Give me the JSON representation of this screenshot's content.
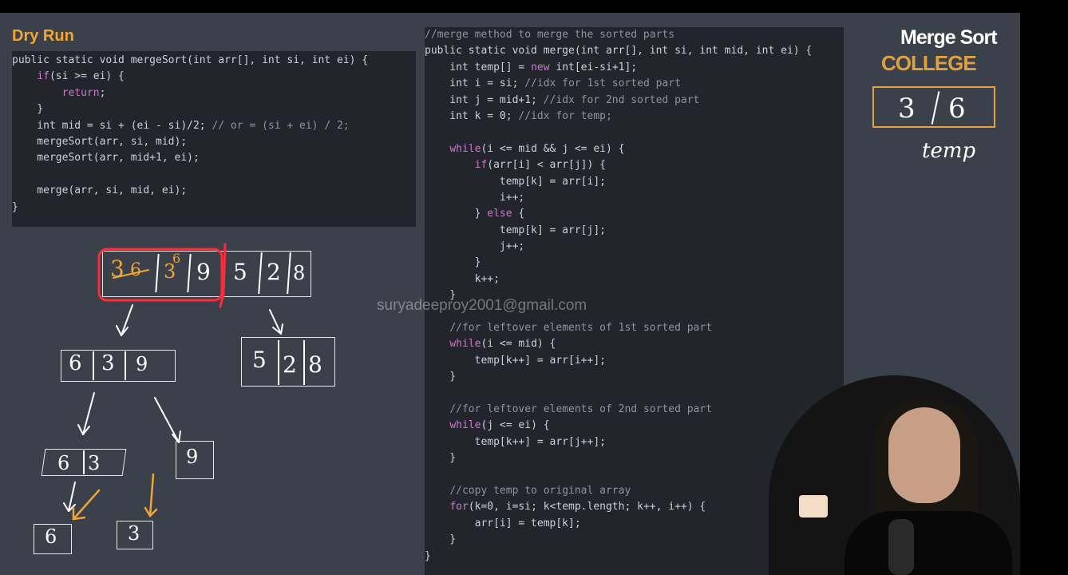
{
  "dry_run_title": "Dry Run",
  "brand_title": "Merge Sort",
  "brand_logo": "COLLEGE",
  "watermark": "suryadeeproy2001@gmail.com",
  "temp_label": "temp",
  "temp_values": [
    "3",
    "6"
  ],
  "merge_sort_code": [
    [
      {
        "t": "public static void mergeSort(int arr[], int si, int ei) {",
        "c": ""
      }
    ],
    [
      {
        "t": "    ",
        "c": ""
      },
      {
        "t": "if",
        "c": "k"
      },
      {
        "t": "(si >= ei) {",
        "c": ""
      }
    ],
    [
      {
        "t": "        ",
        "c": ""
      },
      {
        "t": "return",
        "c": "k"
      },
      {
        "t": ";",
        "c": ""
      }
    ],
    [
      {
        "t": "    }",
        "c": ""
      }
    ],
    [
      {
        "t": "    int mid = si + (ei - si)/2; ",
        "c": ""
      },
      {
        "t": "// or = (si + ei) / 2;",
        "c": "c"
      }
    ],
    [
      {
        "t": "    mergeSort(arr, si, mid);",
        "c": ""
      }
    ],
    [
      {
        "t": "    mergeSort(arr, mid+1, ei);",
        "c": ""
      }
    ],
    [
      {
        "t": "",
        "c": ""
      }
    ],
    [
      {
        "t": "    merge(arr, si, mid, ei);",
        "c": ""
      }
    ],
    [
      {
        "t": "}",
        "c": ""
      }
    ]
  ],
  "merge_code": [
    [
      {
        "t": "//merge method to merge the sorted parts",
        "c": "c"
      }
    ],
    [
      {
        "t": "public static void merge(int arr[], int si, int mid, int ei) {",
        "c": ""
      }
    ],
    [
      {
        "t": "    int temp[] = ",
        "c": ""
      },
      {
        "t": "new",
        "c": "k"
      },
      {
        "t": " int[ei-si+1];",
        "c": ""
      }
    ],
    [
      {
        "t": "    int i = si; ",
        "c": ""
      },
      {
        "t": "//idx for 1st sorted part",
        "c": "c"
      }
    ],
    [
      {
        "t": "    int j = mid+1; ",
        "c": ""
      },
      {
        "t": "//idx for 2nd sorted part",
        "c": "c"
      }
    ],
    [
      {
        "t": "    int k = 0; ",
        "c": ""
      },
      {
        "t": "//idx for temp;",
        "c": "c"
      }
    ],
    [
      {
        "t": "",
        "c": ""
      }
    ],
    [
      {
        "t": "    ",
        "c": ""
      },
      {
        "t": "while",
        "c": "k"
      },
      {
        "t": "(i <= mid && j <= ei) {",
        "c": ""
      }
    ],
    [
      {
        "t": "        ",
        "c": ""
      },
      {
        "t": "if",
        "c": "k"
      },
      {
        "t": "(arr[i] < arr[j]) {",
        "c": ""
      }
    ],
    [
      {
        "t": "            temp[k] = arr[i];",
        "c": ""
      }
    ],
    [
      {
        "t": "            i++;",
        "c": ""
      }
    ],
    [
      {
        "t": "        } ",
        "c": ""
      },
      {
        "t": "else",
        "c": "k"
      },
      {
        "t": " {",
        "c": ""
      }
    ],
    [
      {
        "t": "            temp[k] = arr[j];",
        "c": ""
      }
    ],
    [
      {
        "t": "            j++;",
        "c": ""
      }
    ],
    [
      {
        "t": "        }",
        "c": ""
      }
    ],
    [
      {
        "t": "        k++;",
        "c": ""
      }
    ],
    [
      {
        "t": "    }",
        "c": ""
      }
    ],
    [
      {
        "t": "",
        "c": ""
      }
    ],
    [
      {
        "t": "    ",
        "c": ""
      },
      {
        "t": "//for leftover elements of 1st sorted part",
        "c": "c"
      }
    ],
    [
      {
        "t": "    ",
        "c": ""
      },
      {
        "t": "while",
        "c": "k"
      },
      {
        "t": "(i <= mid) {",
        "c": ""
      }
    ],
    [
      {
        "t": "        temp[k++] = arr[i++];",
        "c": ""
      }
    ],
    [
      {
        "t": "    }",
        "c": ""
      }
    ],
    [
      {
        "t": "",
        "c": ""
      }
    ],
    [
      {
        "t": "    ",
        "c": ""
      },
      {
        "t": "//for leftover elements of 2nd sorted part",
        "c": "c"
      }
    ],
    [
      {
        "t": "    ",
        "c": ""
      },
      {
        "t": "while",
        "c": "k"
      },
      {
        "t": "(j <= ei) {",
        "c": ""
      }
    ],
    [
      {
        "t": "        temp[k++] = arr[j++];",
        "c": ""
      }
    ],
    [
      {
        "t": "    }",
        "c": ""
      }
    ],
    [
      {
        "t": "",
        "c": ""
      }
    ],
    [
      {
        "t": "    ",
        "c": ""
      },
      {
        "t": "//copy temp to original array",
        "c": "c"
      }
    ],
    [
      {
        "t": "    ",
        "c": ""
      },
      {
        "t": "for",
        "c": "k"
      },
      {
        "t": "(k=0, i=si; k<temp.length; k++, i++) {",
        "c": ""
      }
    ],
    [
      {
        "t": "        arr[i] = temp[k];",
        "c": ""
      }
    ],
    [
      {
        "t": "    }",
        "c": ""
      }
    ],
    [
      {
        "t": "}",
        "c": ""
      }
    ]
  ],
  "diagram": {
    "root_left": [
      "3",
      "6",
      "3",
      "6",
      "9"
    ],
    "root_right": [
      "5",
      "2",
      "8"
    ],
    "level1_left": [
      "6",
      "3",
      "9"
    ],
    "level1_right": [
      "5",
      "2",
      "8"
    ],
    "level2_left": [
      "6",
      "3"
    ],
    "level2_right": [
      "9"
    ],
    "leaf_a": "6",
    "leaf_b": "3"
  },
  "colors": {
    "slide_bg": "#3a414a",
    "code_bg": "#22262c",
    "accent_orange": "#f0a535",
    "highlight_red": "#ff2a3a"
  }
}
